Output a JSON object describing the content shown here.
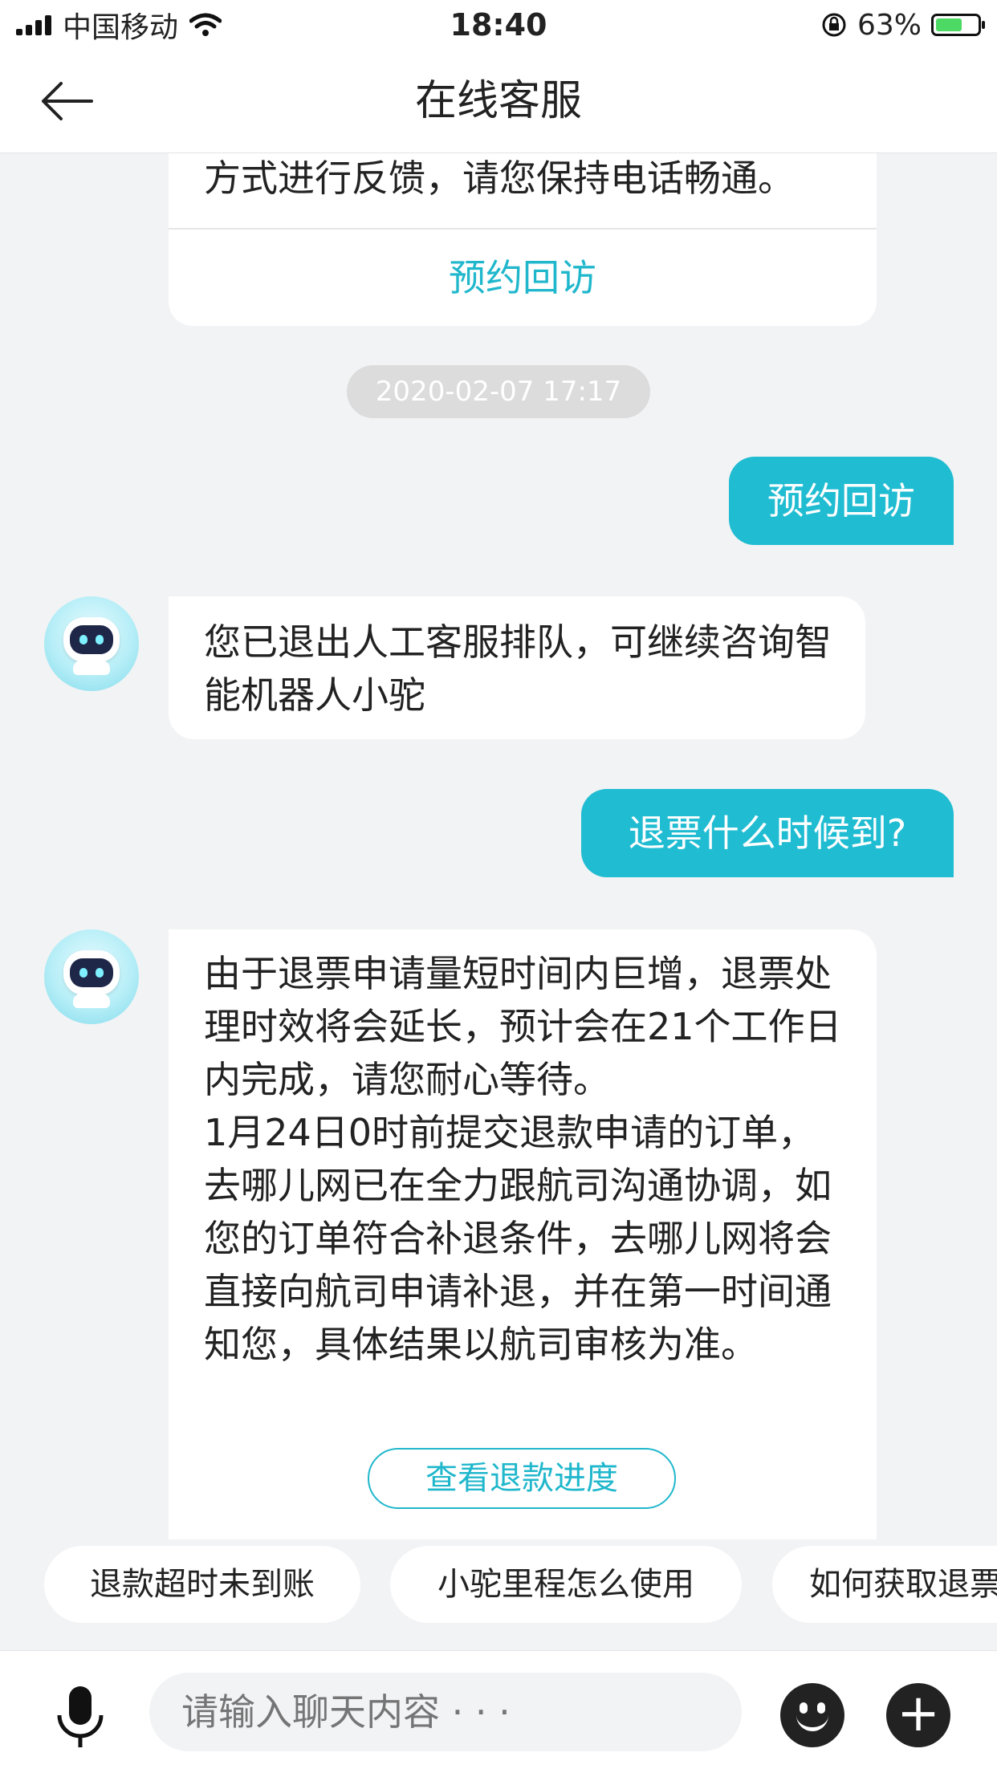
{
  "status_bar": {
    "carrier": "中国移动",
    "time": "18:40",
    "battery": "63%",
    "battery_level": 0.63,
    "icons": [
      "signal-icon",
      "wifi-icon",
      "rotation-lock-icon",
      "battery-icon"
    ]
  },
  "nav": {
    "title": "在线客服",
    "back_icon": "back-arrow-icon"
  },
  "messages": {
    "card_top": {
      "text": "方式进行反馈，请您保持电话畅通。",
      "link": "预约回访"
    },
    "timestamp": "2020-02-07 17:17",
    "user1": "预约回访",
    "bot1": "您已退出人工客服排队，可继续咨询智能机器人小驼",
    "user2": "退票什么时候到?",
    "bot2": "由于退票申请量短时间内巨增，退票处理时效将会延长，预计会在21个工作日内完成，请您耐心等待。\n1月24日0时前提交退款申请的订单，去哪儿网已在全力跟航司沟通协调，如您的订单符合补退条件，去哪儿网将会直接向航司申请补退，并在第一时间通知您，具体结果以航司审核为准。",
    "bot2_button": "查看退款进度"
  },
  "quick_replies": [
    "退款超时未到账",
    "小驼里程怎么使用",
    "如何获取退票"
  ],
  "input": {
    "placeholder": "请输入聊天内容 · · ·",
    "value": ""
  },
  "colors": {
    "accent": "#20bcd2",
    "background": "#f2f3f5"
  }
}
